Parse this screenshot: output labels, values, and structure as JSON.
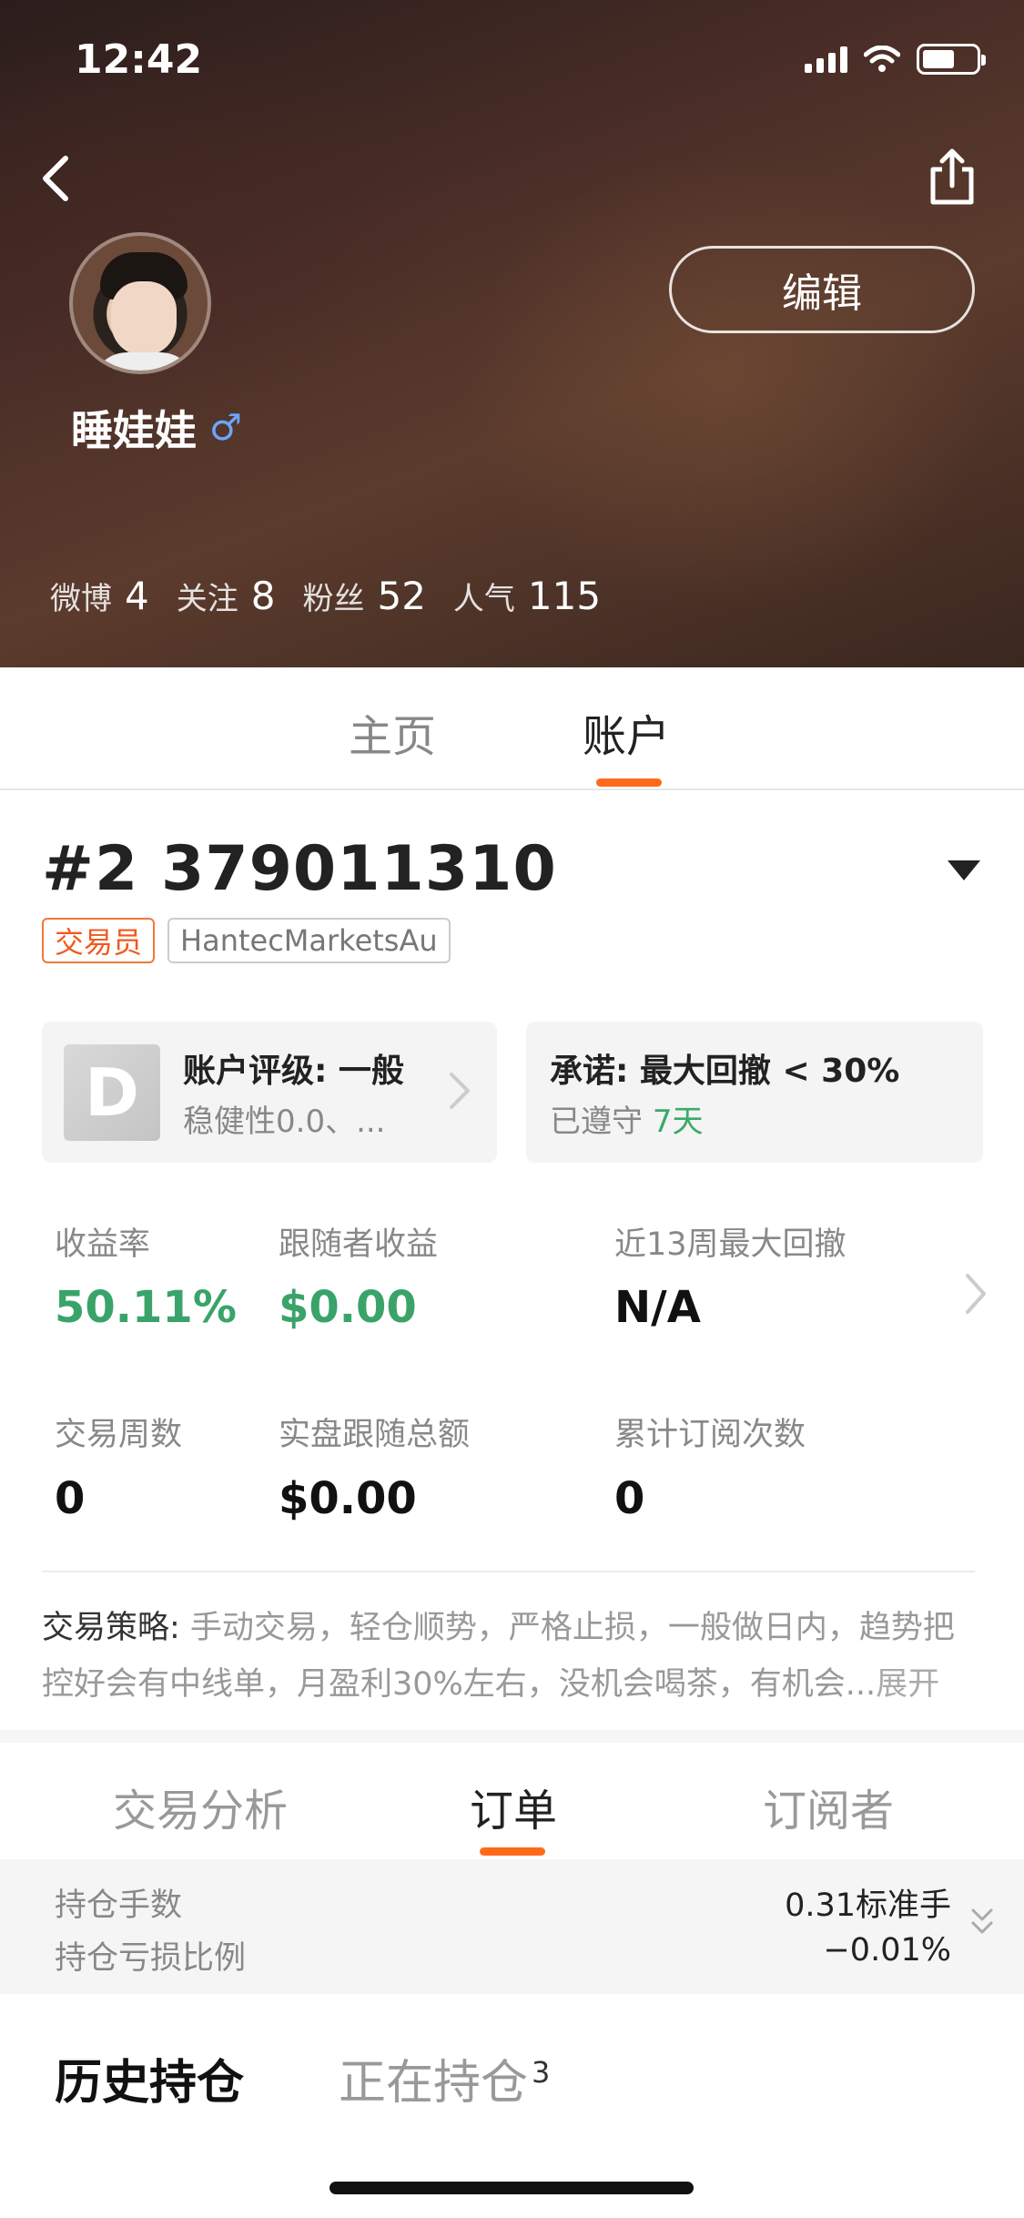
{
  "status_bar": {
    "time": "12:42"
  },
  "profile": {
    "username": "睡娃娃",
    "gender_symbol": "♂",
    "edit_label": "编辑",
    "stats": [
      {
        "label": "微博",
        "value": "4"
      },
      {
        "label": "关注",
        "value": "8"
      },
      {
        "label": "粉丝",
        "value": "52"
      },
      {
        "label": "人气",
        "value": "115"
      }
    ]
  },
  "top_tabs": [
    {
      "label": "主页",
      "active": false
    },
    {
      "label": "账户",
      "active": true
    }
  ],
  "account": {
    "number": "#2 379011310",
    "badges": [
      "交易员",
      "HantecMarketsAu"
    ],
    "rating_grade": "D",
    "rating_title": "账户评级: 一般",
    "rating_sub": "稳健性0.0、...",
    "promise_title": "承诺: 最大回撤 < 30%",
    "promise_sub_prefix": "已遵守",
    "promise_days": "7天"
  },
  "metrics": [
    {
      "label": "收益率",
      "value": "50.11%"
    },
    {
      "label": "跟随者收益",
      "value": "$0.00"
    },
    {
      "label": "近13周最大回撤",
      "value": "N/A"
    },
    {
      "label": "交易周数",
      "value": "0"
    },
    {
      "label": "实盘跟随总额",
      "value": "$0.00"
    },
    {
      "label": "累计订阅次数",
      "value": "0"
    }
  ],
  "strategy": {
    "label": "交易策略:",
    "text": " 手动交易，轻仓顺势，严格止损，一般做日内，趋势把控好会有中线单，月盈利30%左右，没机会喝茶，有机会",
    "ellipsis": "...",
    "expand": "展开"
  },
  "sub_tabs": [
    {
      "label": "交易分析",
      "active": false
    },
    {
      "label": "订单",
      "active": true
    },
    {
      "label": "订阅者",
      "active": false
    }
  ],
  "summary": {
    "lots_label": "持仓手数",
    "lots_value": "0.31标准手",
    "pl_label": "持仓亏损比例",
    "pl_value": "−0.01%"
  },
  "position_tabs": {
    "history": "历史持仓",
    "open": "正在持仓",
    "open_count": "3"
  },
  "colors": {
    "accent": "#ff6a1a",
    "positive": "#3aa36a",
    "badge_trader": "#f05a1e"
  },
  "icons": {
    "back": "chevron-left-icon",
    "share": "share-icon",
    "caret": "caret-down-icon",
    "chevron": "chevron-right-icon",
    "expand": "double-chevron-down-icon"
  }
}
